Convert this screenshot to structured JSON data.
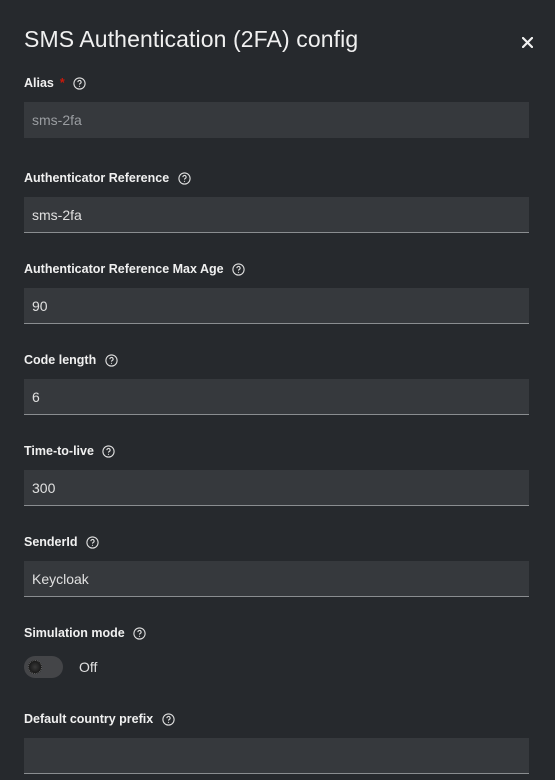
{
  "modal": {
    "title": "SMS Authentication (2FA) config",
    "close_label": "×"
  },
  "fields": {
    "alias": {
      "label": "Alias",
      "required_mark": "*",
      "value": "sms-2fa"
    },
    "authenticator_reference": {
      "label": "Authenticator Reference",
      "value": "sms-2fa"
    },
    "authenticator_reference_max_age": {
      "label": "Authenticator Reference Max Age",
      "value": "90"
    },
    "code_length": {
      "label": "Code length",
      "value": "6"
    },
    "time_to_live": {
      "label": "Time-to-live",
      "value": "300"
    },
    "sender_id": {
      "label": "SenderId",
      "value": "Keycloak"
    },
    "simulation_mode": {
      "label": "Simulation mode",
      "state_label": "Off"
    },
    "default_country_prefix": {
      "label": "Default country prefix",
      "value": ""
    }
  },
  "colors": {
    "background": "#26292d",
    "input_background": "#36393d",
    "required": "#c9190b"
  },
  "icons": {
    "help": "question-circle-icon",
    "close": "close-icon"
  }
}
